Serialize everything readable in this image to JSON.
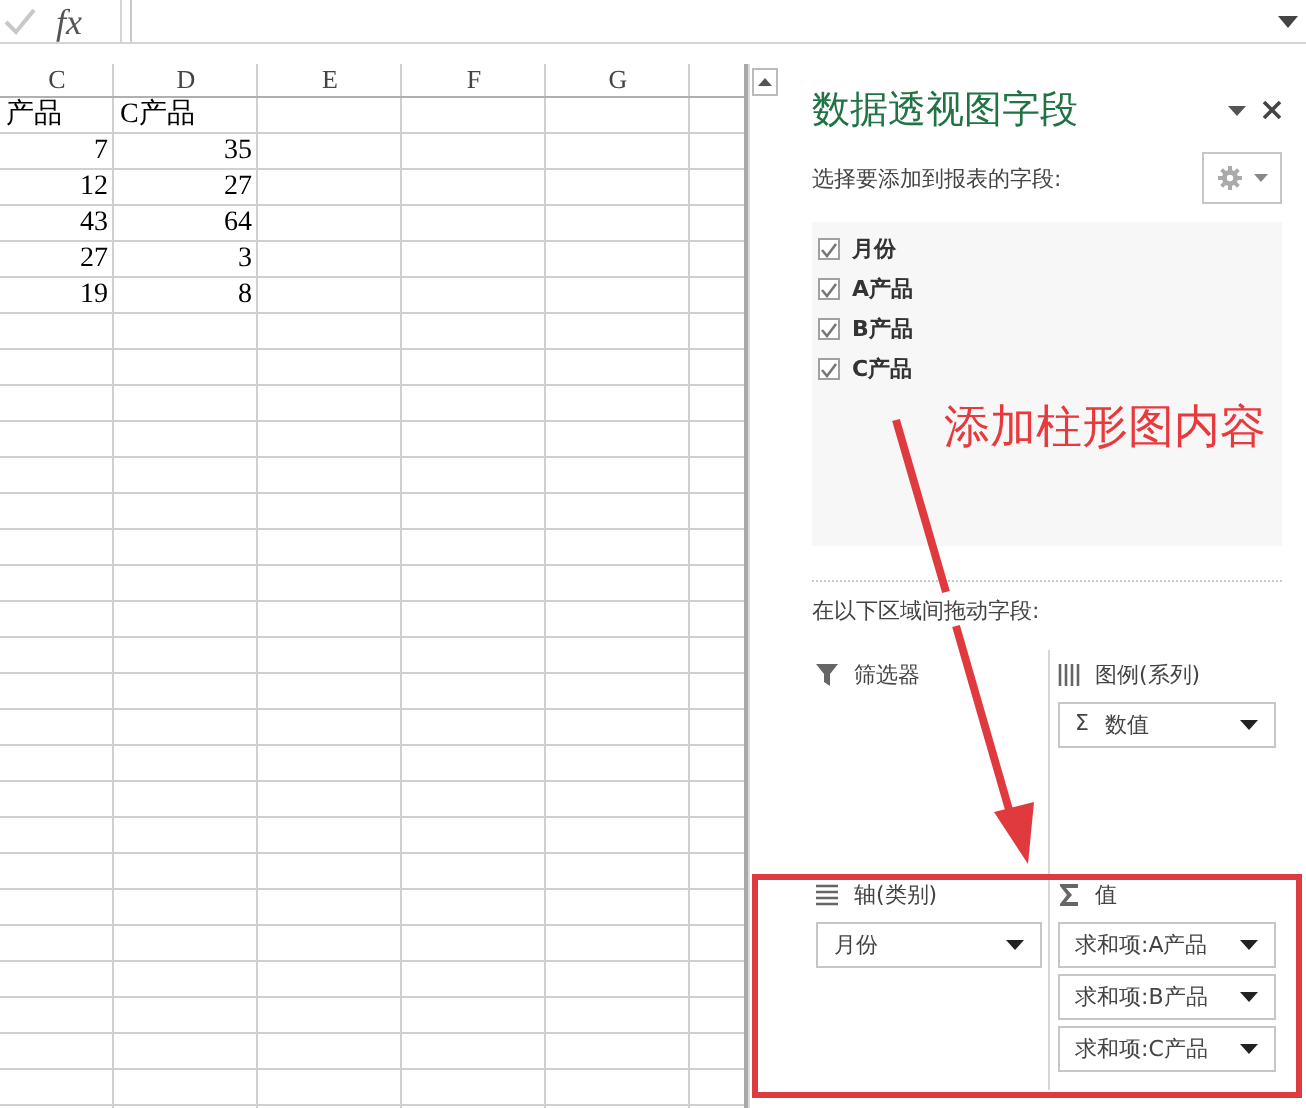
{
  "formula_bar": {
    "function_label": "fx"
  },
  "sheet": {
    "columns": [
      "C",
      "D",
      "E",
      "F",
      "G"
    ],
    "rows": [
      {
        "kind": "text",
        "cells": [
          "产品",
          "C产品"
        ]
      },
      {
        "kind": "number",
        "cells": [
          "7",
          "35"
        ]
      },
      {
        "kind": "number",
        "cells": [
          "12",
          "27"
        ]
      },
      {
        "kind": "number",
        "cells": [
          "43",
          "64"
        ]
      },
      {
        "kind": "number",
        "cells": [
          "27",
          "3"
        ]
      },
      {
        "kind": "number",
        "cells": [
          "19",
          "8"
        ]
      }
    ]
  },
  "pivot_pane": {
    "title": "数据透视图字段",
    "prompt": "选择要添加到报表的字段:",
    "fields": [
      {
        "label": "月份",
        "checked": true
      },
      {
        "label": "A产品",
        "checked": true
      },
      {
        "label": "B产品",
        "checked": true
      },
      {
        "label": "C产品",
        "checked": true
      }
    ],
    "areas_prompt": "在以下区域间拖动字段:",
    "areas": [
      {
        "kind": "filter",
        "label": "筛选器"
      },
      {
        "kind": "legend",
        "label": "图例(系列)",
        "items": [
          {
            "symbol": "Σ",
            "label": "数值"
          }
        ]
      },
      {
        "kind": "axis",
        "label": "轴(类别)",
        "items": [
          {
            "label": "月份"
          }
        ]
      },
      {
        "kind": "values",
        "label": "值",
        "items": [
          {
            "label": "求和项:A产品"
          },
          {
            "label": "求和项:B产品"
          },
          {
            "label": "求和项:C产品"
          }
        ]
      }
    ]
  },
  "annotation": {
    "text": "添加柱形图内容"
  }
}
